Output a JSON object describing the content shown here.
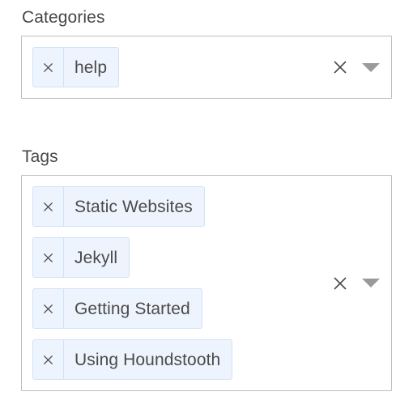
{
  "colors": {
    "chip_background": "#eef4fd",
    "chip_border": "#cfe2fa",
    "box_border": "#bfbfbf",
    "text": "#4a4a4a",
    "label_text": "#474747",
    "caret": "#9a9a9a",
    "page_background": "#ffffff"
  },
  "fields": [
    {
      "label": "Categories",
      "chips": [
        {
          "remove_icon": "close-icon",
          "label": "help"
        }
      ],
      "clear_icon": "close-icon",
      "dropdown_icon": "chevron-down-icon"
    },
    {
      "label": "Tags",
      "chips": [
        {
          "remove_icon": "close-icon",
          "label": "Static Websites"
        },
        {
          "remove_icon": "close-icon",
          "label": "Jekyll"
        },
        {
          "remove_icon": "close-icon",
          "label": "Getting Started"
        },
        {
          "remove_icon": "close-icon",
          "label": "Using Houndstooth"
        }
      ],
      "clear_icon": "close-icon",
      "dropdown_icon": "chevron-down-icon"
    }
  ]
}
